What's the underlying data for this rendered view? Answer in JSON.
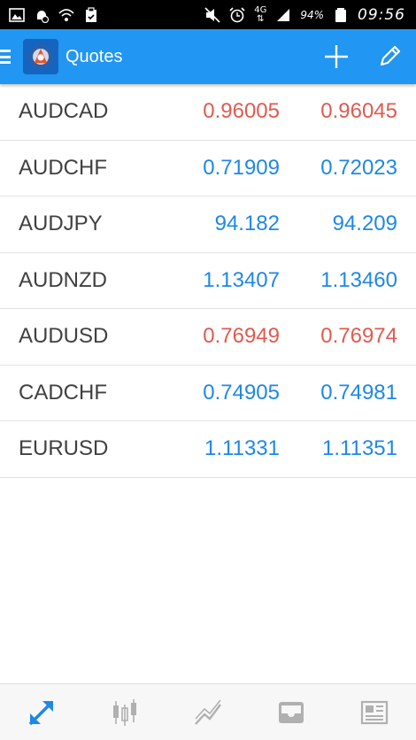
{
  "status_bar": {
    "battery": "94%",
    "time": "09:56",
    "network": "4G",
    "icons_left": [
      "gallery-icon",
      "android-debug-icon",
      "wifi-icon",
      "clipboard-icon"
    ],
    "icons_right": [
      "mute-icon",
      "alarm-icon",
      "network-4g-icon",
      "signal-icon",
      "battery-icon"
    ]
  },
  "app_bar": {
    "title": "Quotes",
    "color": "#2196f3",
    "icons": [
      "menu-icon",
      "app-logo-icon",
      "add-icon",
      "edit-icon"
    ]
  },
  "quotes": [
    {
      "symbol": "AUDCAD",
      "bid": "0.96005",
      "ask": "0.96045",
      "color": "red"
    },
    {
      "symbol": "AUDCHF",
      "bid": "0.71909",
      "ask": "0.72023",
      "color": "blue"
    },
    {
      "symbol": "AUDJPY",
      "bid": "94.182",
      "ask": "94.209",
      "color": "blue"
    },
    {
      "symbol": "AUDNZD",
      "bid": "1.13407",
      "ask": "1.13460",
      "color": "blue"
    },
    {
      "symbol": "AUDUSD",
      "bid": "0.76949",
      "ask": "0.76974",
      "color": "red"
    },
    {
      "symbol": "CADCHF",
      "bid": "0.74905",
      "ask": "0.74981",
      "color": "blue"
    },
    {
      "symbol": "EURUSD",
      "bid": "1.11331",
      "ask": "1.11351",
      "color": "blue"
    }
  ],
  "colors": {
    "price_up": "#1e88e5",
    "price_down": "#e05a4f",
    "active_nav": "#1e88e5",
    "inactive_nav": "#b0b0b0"
  },
  "bottom_nav": [
    {
      "name": "quotes-icon",
      "active": true
    },
    {
      "name": "chart-icon",
      "active": false
    },
    {
      "name": "trade-icon",
      "active": false
    },
    {
      "name": "history-icon",
      "active": false
    },
    {
      "name": "news-icon",
      "active": false
    }
  ]
}
